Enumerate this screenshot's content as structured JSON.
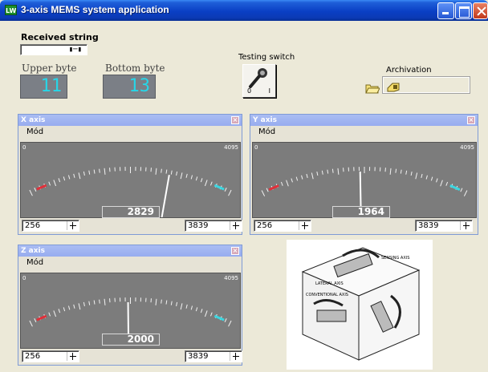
{
  "window": {
    "title": "3-axis MEMS system application",
    "app_icon": "LW"
  },
  "received": {
    "label": "Received string",
    "value": "▮─▮"
  },
  "bytes": {
    "upper_label": "Upper byte",
    "upper_value": "11",
    "bottom_label": "Bottom byte",
    "bottom_value": "13"
  },
  "testing": {
    "label": "Testing switch",
    "off_mark": "0",
    "on_mark": "I"
  },
  "archivation": {
    "label": "Archivation"
  },
  "axes": [
    {
      "title": "X axis",
      "menu": "Mód",
      "min": 0,
      "max": 4095,
      "value": 2829,
      "low": "256",
      "high": "3839"
    },
    {
      "title": "Y axis",
      "menu": "Mód",
      "min": 0,
      "max": 4095,
      "value": 1964,
      "low": "256",
      "high": "3839"
    },
    {
      "title": "Z axis",
      "menu": "Mód",
      "min": 0,
      "max": 4095,
      "value": 2000,
      "low": "256",
      "high": "3839"
    }
  ],
  "cube_labels": [
    "SENSING AXIS",
    "LATERAL AXIS",
    "CONVENTIONAL AXIS"
  ],
  "colors": {
    "lcd_text": "#27d6e8",
    "low_zone": "#e0303a",
    "high_zone": "#3cd6e0"
  },
  "icons": [
    "app-icon",
    "minimize-icon",
    "maximize-icon",
    "close-icon",
    "key-switch-icon",
    "folder-icon",
    "save-icon"
  ]
}
